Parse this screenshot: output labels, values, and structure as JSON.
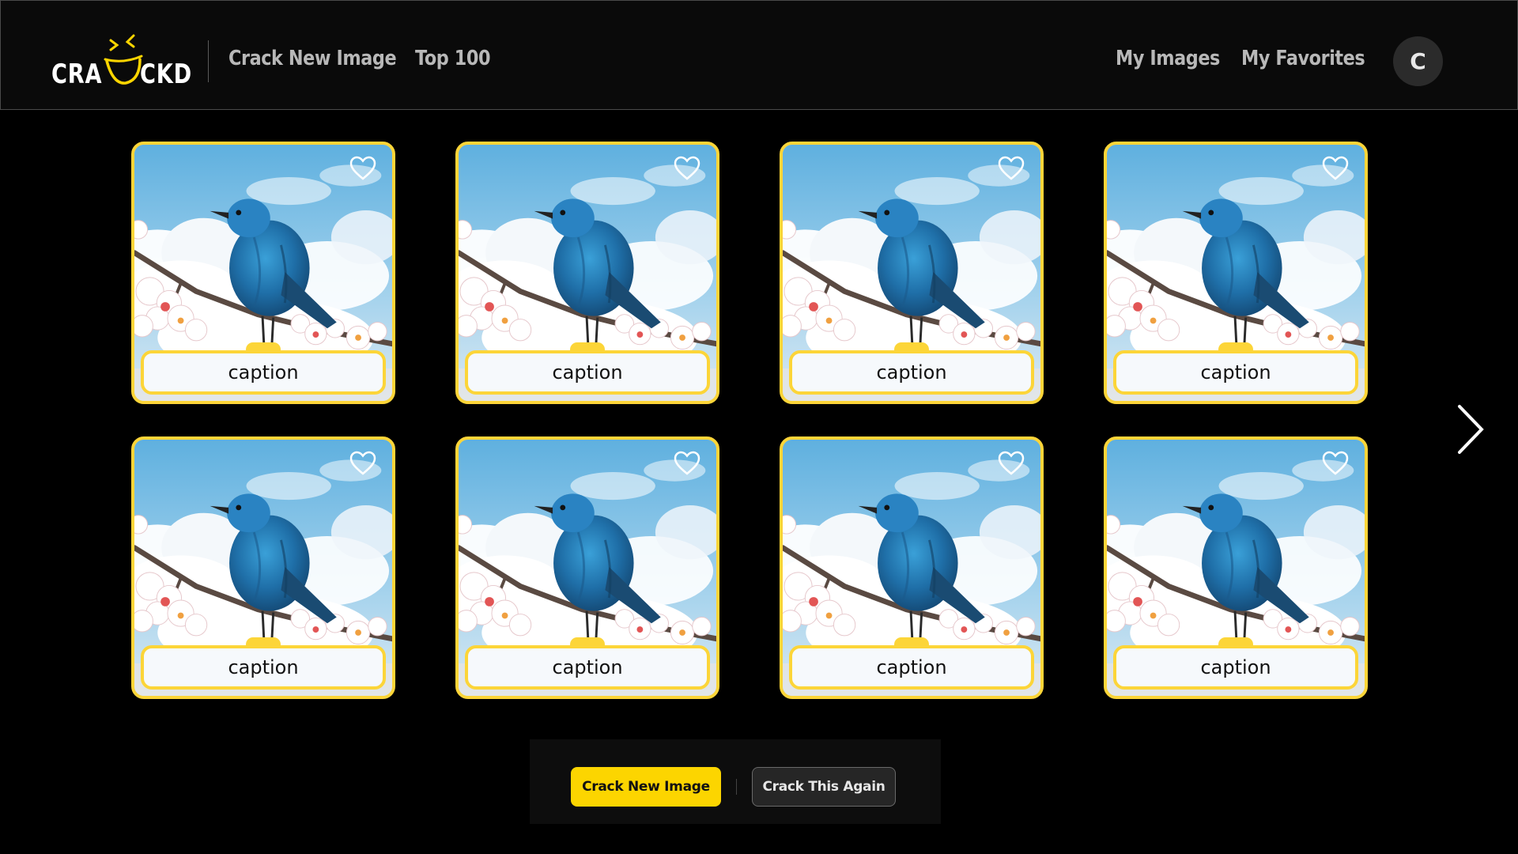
{
  "header": {
    "logo_left": "CRA",
    "logo_right": "CKD",
    "nav_left": [
      "Crack New Image",
      "Top 100"
    ],
    "nav_right": [
      "My Images",
      "My Favorites"
    ],
    "avatar_initial": "C"
  },
  "gallery": {
    "cards": [
      {
        "caption": "caption",
        "favorited": false
      },
      {
        "caption": "caption",
        "favorited": false
      },
      {
        "caption": "caption",
        "favorited": false
      },
      {
        "caption": "caption",
        "favorited": false
      },
      {
        "caption": "caption",
        "favorited": false
      },
      {
        "caption": "caption",
        "favorited": false
      },
      {
        "caption": "caption",
        "favorited": false
      },
      {
        "caption": "caption",
        "favorited": false
      }
    ],
    "next_icon": "chevron-right-icon"
  },
  "actions": {
    "primary_label": "Crack New Image",
    "secondary_label": "Crack This Again"
  },
  "colors": {
    "accent": "#fcd500",
    "background": "#000000",
    "header_bg": "#0a0a0a",
    "nav_text": "#b8b8b8"
  }
}
